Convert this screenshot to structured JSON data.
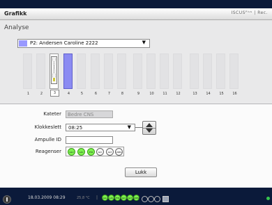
{
  "window": {
    "title": "Grafikk",
    "brand": "ISCUSᴾˡᵘˢ | Rec."
  },
  "section_title": "Analyse",
  "patient_select": {
    "value": "P2: Andersen Caroline 2222",
    "arrow": "▼",
    "swatch_color": "#9999ff"
  },
  "slots": {
    "labels": [
      "1",
      "2",
      "3",
      "4",
      "5",
      "6",
      "7",
      "8",
      "9",
      "10",
      "11",
      "12",
      "13",
      "14",
      "15",
      "16"
    ],
    "selected": "3",
    "occupied": "4"
  },
  "form": {
    "kateter_label": "Kateter",
    "kateter_value": "Bedre CNS",
    "klokkeslett_label": "Klokkeslett",
    "klokkeslett_value": "08:25",
    "klokkeslett_arrow": "▼",
    "ampulle_label": "Ampulle ID",
    "ampulle_value": "",
    "reagenser_label": "Reagenser",
    "reagents": [
      {
        "name": "GLU",
        "active": true
      },
      {
        "name": "LAC",
        "active": true
      },
      {
        "name": "PYR",
        "active": true
      },
      {
        "name": "GLY",
        "active": false
      },
      {
        "name": "GLT",
        "active": false
      },
      {
        "name": "UREA",
        "active": false
      }
    ]
  },
  "buttons": {
    "close_label": "Lukk"
  },
  "taskbar": {
    "datetime": "18.03.2009 08:29",
    "temperature": "25,8 °C",
    "separator": "|",
    "indicators": [
      {
        "name": "GLU",
        "active": true
      },
      {
        "name": "LAC",
        "active": true
      },
      {
        "name": "PYR",
        "active": true
      },
      {
        "name": "GLY",
        "active": true
      },
      {
        "name": "GLT",
        "active": true
      },
      {
        "name": "UREA",
        "active": true
      },
      {
        "name": "",
        "active": false
      },
      {
        "name": "",
        "active": false
      },
      {
        "name": "",
        "active": false
      }
    ]
  }
}
